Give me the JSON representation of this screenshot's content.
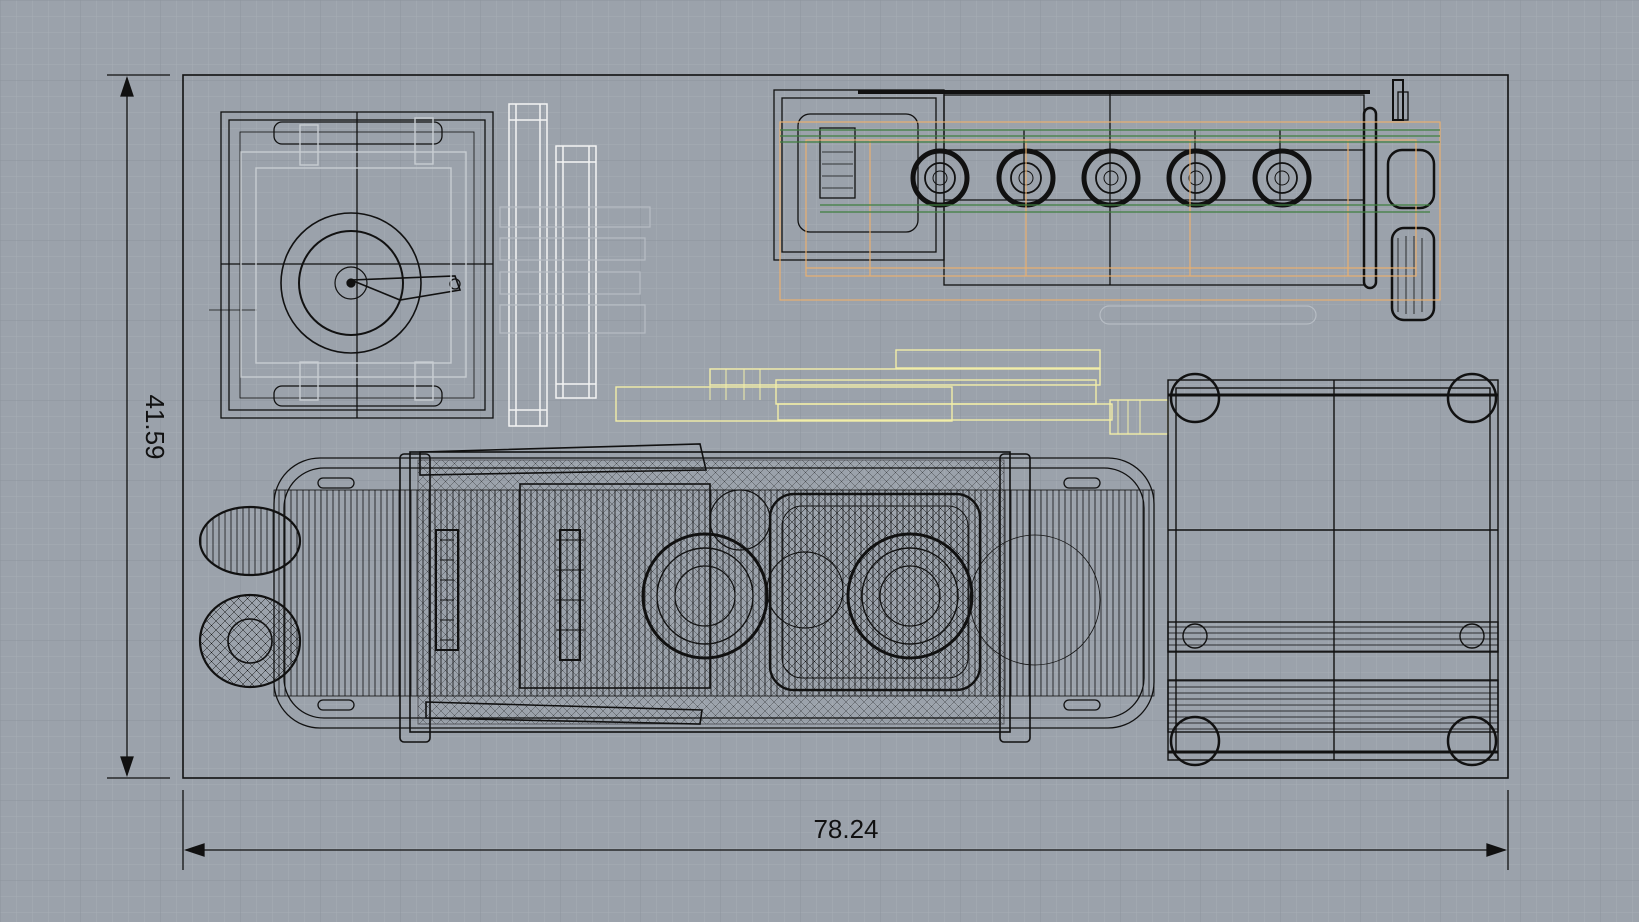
{
  "viewport": {
    "view": "Top",
    "background_color": "#9ba2ab",
    "grid_minor_color": "#a6adb5",
    "grid_major_color": "#8b939c",
    "wire_color": "#111111",
    "highlight_colors": [
      "#ffffff",
      "#e8b070",
      "#f2eea8",
      "#3f7f3f"
    ]
  },
  "dimensions": {
    "width_label": "78.24",
    "height_label": "41.59"
  }
}
